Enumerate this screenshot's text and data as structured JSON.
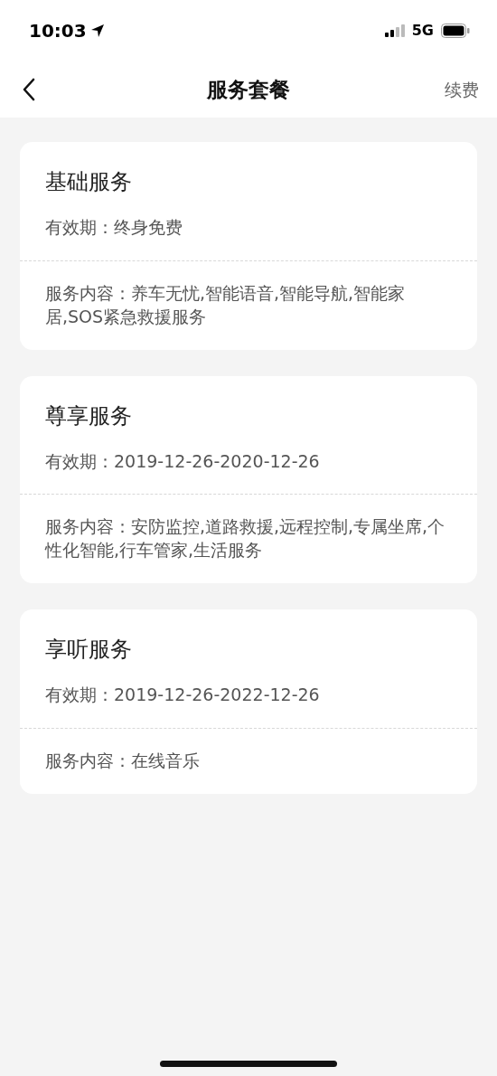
{
  "status_bar": {
    "time": "10:03",
    "network": "5G"
  },
  "nav": {
    "title": "服务套餐",
    "action": "续费"
  },
  "packages": [
    {
      "name": "基础服务",
      "validity_label": "有效期：",
      "validity": "终身免费",
      "content_label": "服务内容：",
      "content": "养车无忧,智能语音,智能导航,智能家居,SOS紧急救援服务"
    },
    {
      "name": "尊享服务",
      "validity_label": "有效期：",
      "validity": "2019-12-26-2020-12-26",
      "content_label": "服务内容：",
      "content": "安防监控,道路救援,远程控制,专属坐席,个性化智能,行车管家,生活服务"
    },
    {
      "name": "享听服务",
      "validity_label": "有效期：",
      "validity": "2019-12-26-2022-12-26",
      "content_label": "服务内容：",
      "content": "在线音乐"
    }
  ]
}
